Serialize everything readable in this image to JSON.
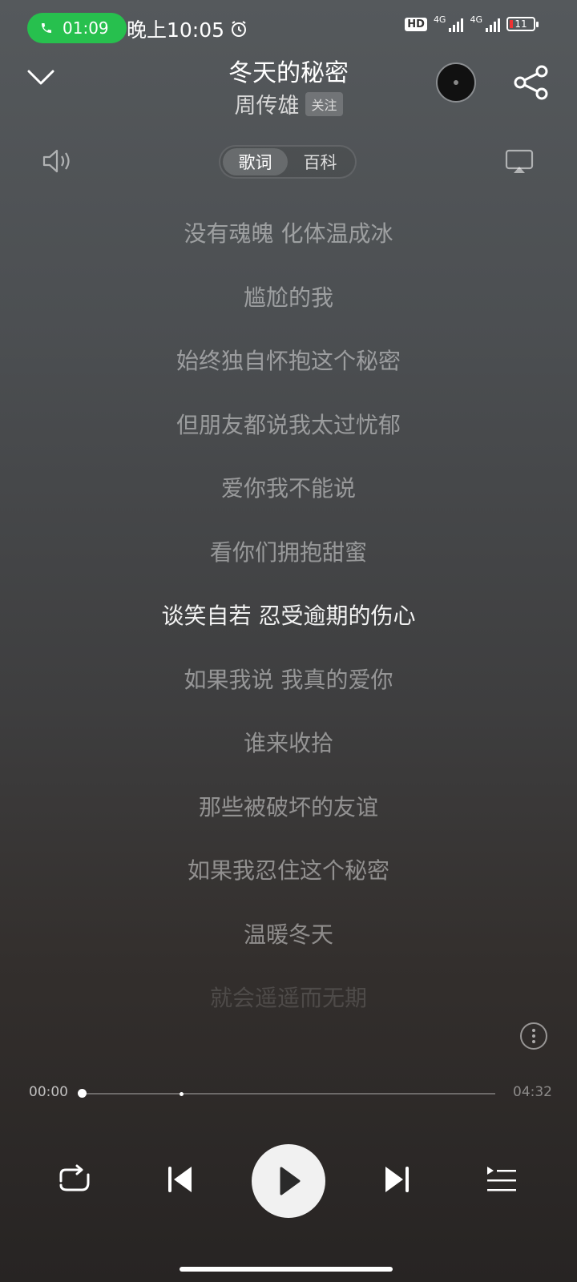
{
  "status_bar": {
    "call_time": "01:09",
    "clock": "晚上10:05",
    "hd": "HD",
    "network_1": "4G",
    "network_2": "4G",
    "battery": "11"
  },
  "header": {
    "title": "冬天的秘密",
    "artist": "周传雄",
    "follow_label": "关注"
  },
  "tabs": [
    {
      "label": "歌词",
      "active": true
    },
    {
      "label": "百科",
      "active": false
    }
  ],
  "lyrics": [
    {
      "text": "没有魂魄 化体温成冰",
      "state": "normal"
    },
    {
      "text": "尴尬的我",
      "state": "normal"
    },
    {
      "text": "始终独自怀抱这个秘密",
      "state": "normal"
    },
    {
      "text": "但朋友都说我太过忧郁",
      "state": "normal"
    },
    {
      "text": "爱你我不能说",
      "state": "normal"
    },
    {
      "text": "看你们拥抱甜蜜",
      "state": "normal"
    },
    {
      "text": "谈笑自若 忍受逾期的伤心",
      "state": "current"
    },
    {
      "text": "如果我说 我真的爱你",
      "state": "normal"
    },
    {
      "text": "谁来收拾",
      "state": "normal"
    },
    {
      "text": "那些被破坏的友谊",
      "state": "normal"
    },
    {
      "text": "如果我忍住这个秘密",
      "state": "normal"
    },
    {
      "text": "温暖冬天",
      "state": "normal"
    },
    {
      "text": "就会遥遥而无期",
      "state": "fade"
    }
  ],
  "player": {
    "current_time": "00:00",
    "total_time": "04:32",
    "progress": 0
  },
  "icons": {
    "chevron": "chevron-down-icon",
    "share": "share-icon",
    "speaker": "speaker-icon",
    "cast": "cast-icon",
    "more": "more-vertical-icon",
    "repeat": "repeat-icon",
    "prev": "previous-icon",
    "play": "play-icon",
    "next": "next-icon",
    "queue": "playlist-icon"
  }
}
